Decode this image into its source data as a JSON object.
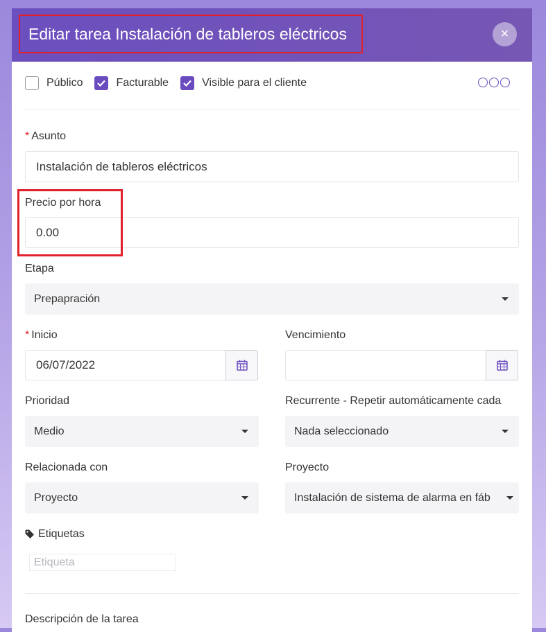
{
  "modal": {
    "title": "Editar tarea Instalación de tableros eléctricos",
    "close_icon": "×"
  },
  "checkboxes": [
    {
      "label": "Público",
      "checked": false
    },
    {
      "label": "Facturable",
      "checked": true
    },
    {
      "label": "Visible para el cliente",
      "checked": true
    }
  ],
  "colors": {
    "accent": "#6a4cbf",
    "highlight": "#e0202a"
  },
  "fields": {
    "subject": {
      "label": "Asunto",
      "value": "Instalación de tableros eléctricos"
    },
    "hourly_rate": {
      "label": "Precio por hora",
      "value": "0.00"
    },
    "stage": {
      "label": "Etapa",
      "value": "Prepapración"
    },
    "start": {
      "label": "Inicio",
      "value": "06/07/2022"
    },
    "due": {
      "label": "Vencimiento",
      "value": ""
    },
    "priority": {
      "label": "Prioridad",
      "value": "Medio"
    },
    "recurring": {
      "label": "Recurrente - Repetir automáticamente cada",
      "value": "Nada seleccionado"
    },
    "related_to": {
      "label": "Relacionada con",
      "value": "Proyecto"
    },
    "project": {
      "label": "Proyecto",
      "value": "Instalación de sistema de alarma en fáb"
    },
    "tags": {
      "label": "Etiquetas",
      "placeholder": "Etiqueta"
    },
    "description": {
      "label": "Descripción de la tarea"
    }
  }
}
